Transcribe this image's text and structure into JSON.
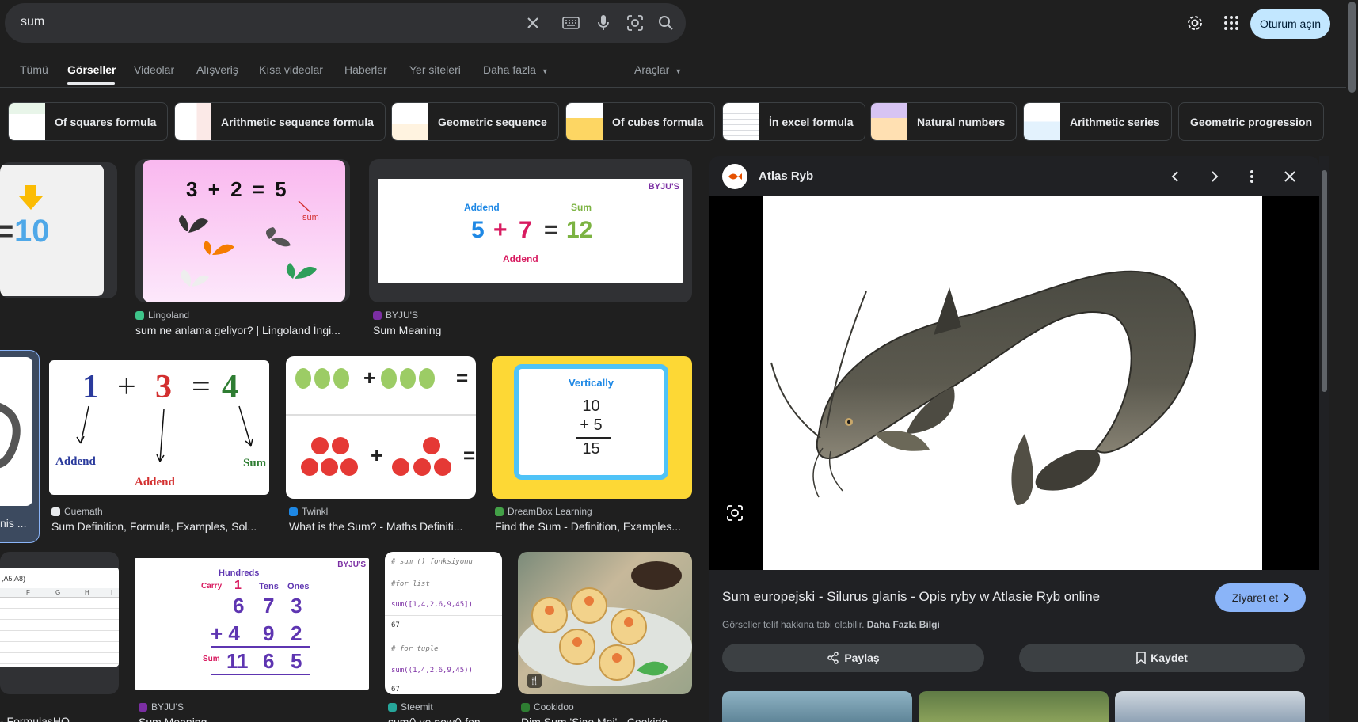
{
  "search": {
    "query": "sum"
  },
  "header": {
    "signin_label": "Oturum açın"
  },
  "tabs": [
    {
      "label": "Tümü"
    },
    {
      "label": "Görseller"
    },
    {
      "label": "Videolar"
    },
    {
      "label": "Alışveriş"
    },
    {
      "label": "Kısa videolar"
    },
    {
      "label": "Haberler"
    },
    {
      "label": "Yer siteleri"
    },
    {
      "label": "Daha fazla"
    }
  ],
  "tools_label": "Araçlar",
  "active_tab": "Görseller",
  "chips": [
    {
      "label": "Of squares formula"
    },
    {
      "label": "Arithmetic sequence formula"
    },
    {
      "label": "Geometric sequence"
    },
    {
      "label": "Of cubes formula"
    },
    {
      "label": "İn excel formula"
    },
    {
      "label": "Natural numbers"
    },
    {
      "label": "Arithmetic series"
    },
    {
      "label": "Geometric progression"
    }
  ],
  "results": [
    {
      "source": "Lingoland",
      "title": "sum ne anlama geliyor? | Lingoland İngi...",
      "img": {
        "eq": "3 + 2 = 5",
        "tag": "sum"
      }
    },
    {
      "source": "BYJU'S",
      "title": "Sum Meaning",
      "img": {
        "brand": "BYJU'S",
        "top1": "Addend",
        "top2": "Sum",
        "a": "5",
        "plus": "+",
        "b": "7",
        "eq": "=",
        "c": "12",
        "bottom": "Addend"
      }
    },
    {
      "source": "Cuemath",
      "title": "Sum Definition, Formula, Examples, Sol...",
      "img": {
        "a": "1",
        "plus": "+",
        "b": "3",
        "eq": "=",
        "c": "4",
        "l1": "Addend",
        "l2": "Addend",
        "l3": "Sum"
      }
    },
    {
      "source": "Twinkl",
      "title": "What is the Sum? - Maths Definiti...",
      "img": {
        "plus": "+",
        "eq": "="
      }
    },
    {
      "source": "DreamBox Learning",
      "title": "Find the Sum - Definition, Examples...",
      "img": {
        "heading": "Vertically",
        "n1": "10",
        "n2": "+ 5",
        "n3": "15"
      }
    },
    {
      "source": "BYJU'S",
      "title": "Sum Meaning",
      "img": {
        "brand": "BYJU'S",
        "h1": "Hundreds",
        "h2": "Tens",
        "h3": "Ones",
        "carry": "Carry",
        "c1": "1",
        "r1": [
          "6",
          "7",
          "3"
        ],
        "r2": [
          "+ 4",
          "9",
          "2"
        ],
        "sumlbl": "Sum",
        "r3": [
          "11",
          "6",
          "5"
        ]
      }
    },
    {
      "source": "Steemit",
      "title": "sum() ve now() fon...",
      "img": {
        "lines": [
          "# sum () fonksiyonu",
          "#for list",
          "sum([1,4,2,6,9,45])",
          "67",
          "# for tuple",
          "sum((1,4,2,6,9,45))",
          "67"
        ]
      }
    },
    {
      "source": "Cookidoo",
      "title": "Dim Sum 'Siao Mai' - Cookido..."
    },
    {
      "title": "nis ...",
      "left_big": "10",
      "left_eq": "="
    },
    {
      "title": "- FormulasHQ",
      "cellref": ",A5,A8)",
      "cols": [
        "F",
        "G",
        "H",
        "I"
      ]
    }
  ],
  "preview": {
    "source": "Atlas Ryb",
    "title": "Sum europejski - Silurus glanis - Opis ryby w Atlasie Ryb online",
    "visit_label": "Ziyaret et",
    "copyright": "Görseller telif hakkına tabi olabilir.",
    "more_info": "Daha Fazla Bilgi",
    "share_label": "Paylaş",
    "save_label": "Kaydet"
  },
  "colors": {
    "background": "#1f1f1f",
    "accent_blue": "#8ab4f8",
    "signin_bg": "#c2e7ff",
    "text": "#e8eaed",
    "muted": "#9aa0a6"
  }
}
